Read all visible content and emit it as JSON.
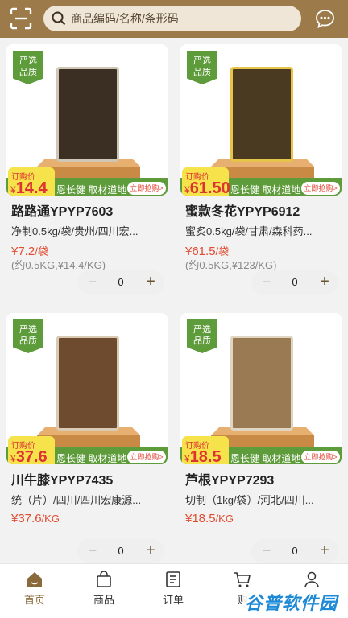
{
  "header": {
    "search_placeholder": "商品编码/名称/条形码",
    "brand_color": "#9c7a4a"
  },
  "products": [
    {
      "tag": [
        "严选",
        "品质"
      ],
      "price_label": "订购价",
      "price_big": "14.4",
      "slogan": "恩长健 取材道地",
      "buy_label": "立即抢购>",
      "name": "路路通YPYP7603",
      "spec": "净制0.5kg/袋/贵州/四川宏...",
      "price": "¥7.2",
      "unit": "/袋",
      "per_kg": "(约0.5KG,¥14.4/KG)",
      "qty": "0",
      "bag_color": "#3a2f22"
    },
    {
      "tag": [
        "严选",
        "品质"
      ],
      "price_label": "订购价",
      "price_big": "61.50",
      "slogan": "恩长健 取材道地",
      "buy_label": "立即抢购>",
      "name": "蜜款冬花YPYP6912",
      "spec": "蜜炙0.5kg/袋/甘肃/森科药...",
      "price": "¥61.5",
      "unit": "/袋",
      "per_kg": "(约0.5KG,¥123/KG)",
      "qty": "0",
      "bag_color": "#4a3a22"
    },
    {
      "tag": [
        "严选",
        "品质"
      ],
      "price_label": "订购价",
      "price_big": "37.6",
      "slogan": "恩长健 取材道地",
      "buy_label": "立即抢购>",
      "name": "川牛膝YPYP7435",
      "spec": "统（片）/四川/四川宏康源...",
      "price": "¥37.6",
      "unit": "/KG",
      "per_kg": "",
      "qty": "0",
      "bag_color": "#6e4a2e"
    },
    {
      "tag": [
        "严选",
        "品质"
      ],
      "price_label": "订购价",
      "price_big": "18.5",
      "slogan": "恩长健 取材道地",
      "buy_label": "立即抢购>",
      "name": "芦根YPYP7293",
      "spec": "切制（1kg/袋）/河北/四川...",
      "price": "¥18.5",
      "unit": "/KG",
      "per_kg": "",
      "qty": "0",
      "bag_color": "#9a7a52"
    }
  ],
  "stepper": {
    "minus": "−",
    "plus": "+"
  },
  "tabbar": [
    {
      "label": "首页",
      "icon": "home-icon",
      "active": true
    },
    {
      "label": "商品",
      "icon": "bag-icon",
      "active": false
    },
    {
      "label": "订单",
      "icon": "order-icon",
      "active": false
    },
    {
      "label": "购",
      "icon": "cart-icon",
      "active": false
    },
    {
      "label": "",
      "icon": "user-icon",
      "active": false
    }
  ],
  "watermark": "谷普软件园"
}
